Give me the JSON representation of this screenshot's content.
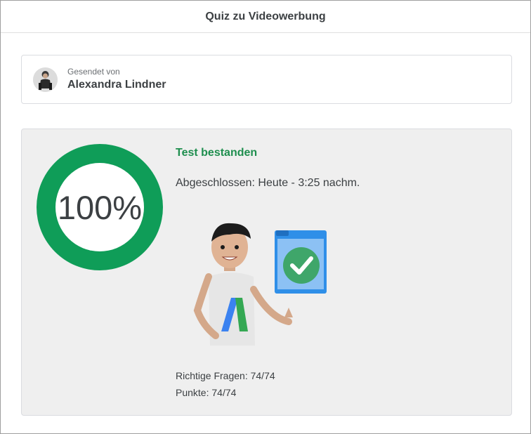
{
  "header": {
    "title": "Quiz zu Videowerbung"
  },
  "sender": {
    "label": "Gesendet von",
    "name": "Alexandra Lindner"
  },
  "result": {
    "score_text": "100%",
    "score_fraction": 1.0,
    "status": "Test bestanden",
    "completed": "Abgeschlossen: Heute - 3:25 nachm.",
    "correct_questions": "Richtige Fragen: 74/74",
    "points": "Punkte: 74/74"
  },
  "colors": {
    "ring": "#0f9d58",
    "status_green": "#1e8e4e",
    "card_bg": "#efefef",
    "clipboard_blue": "#2f8fe8"
  },
  "icons": {
    "avatar": "person-avatar",
    "illustration": "person-with-checkmark-clipboard-illustration"
  }
}
